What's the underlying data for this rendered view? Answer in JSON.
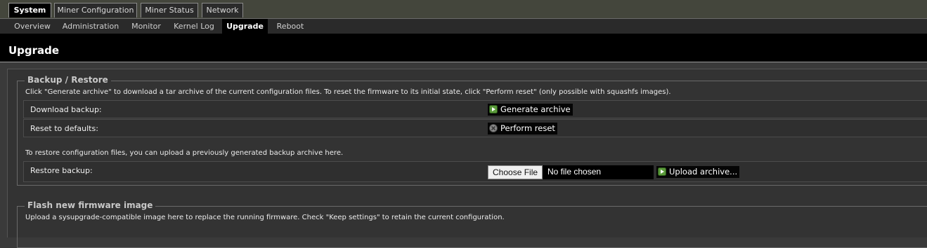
{
  "top_tabs": [
    {
      "label": "System",
      "active": true
    },
    {
      "label": "Miner Configuration",
      "active": false
    },
    {
      "label": "Miner Status",
      "active": false
    },
    {
      "label": "Network",
      "active": false
    }
  ],
  "sub_tabs": [
    {
      "label": "Overview",
      "active": false
    },
    {
      "label": "Administration",
      "active": false
    },
    {
      "label": "Monitor",
      "active": false
    },
    {
      "label": "Kernel Log",
      "active": false
    },
    {
      "label": "Upgrade",
      "active": true
    },
    {
      "label": "Reboot",
      "active": false
    }
  ],
  "page": {
    "title": "Upgrade"
  },
  "backup": {
    "legend": "Backup / Restore",
    "description": "Click \"Generate archive\" to download a tar archive of the current configuration files. To reset the firmware to its initial state, click \"Perform reset\" (only possible with squashfs images).",
    "download_label": "Download backup:",
    "generate_label": "Generate archive",
    "reset_label": "Reset to defaults:",
    "perform_reset_label": "Perform reset",
    "restore_description": "To restore configuration files, you can upload a previously generated backup archive here.",
    "restore_label": "Restore backup:",
    "choose_file_label": "Choose File",
    "no_file_text": "No file chosen",
    "upload_label": "Upload archive..."
  },
  "flash": {
    "legend": "Flash new firmware image",
    "description": "Upload a sysupgrade-compatible image here to replace the running firmware. Check \"Keep settings\" to retain the current configuration."
  },
  "icons": {
    "generate": "play-icon",
    "reset": "reset-icon",
    "upload": "play-icon"
  },
  "colors": {
    "play_icon": "#5a9a3a",
    "reset_icon": "#8a8a8a"
  }
}
